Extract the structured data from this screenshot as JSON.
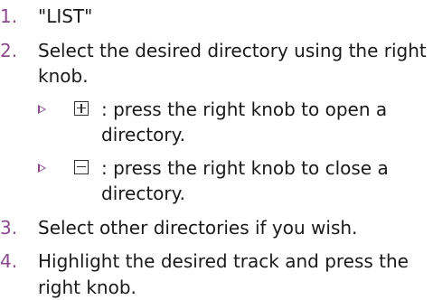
{
  "steps": [
    {
      "num": "1.",
      "text": "\"LIST\""
    },
    {
      "num": "2.",
      "text": "Select the desired directory using the right knob."
    },
    {
      "num": "3.",
      "text": "Select other directories if you wish."
    },
    {
      "num": "4.",
      "text": "Highlight the desired track and press the right knob."
    }
  ],
  "substeps": [
    {
      "icon": "plus-box-icon",
      "text": ": press the right knob to open a directory."
    },
    {
      "icon": "minus-box-icon",
      "text": ": press the right knob to close a directory."
    }
  ],
  "colors": {
    "accent": "#8a4a8c",
    "text": "#1a1a1a"
  }
}
